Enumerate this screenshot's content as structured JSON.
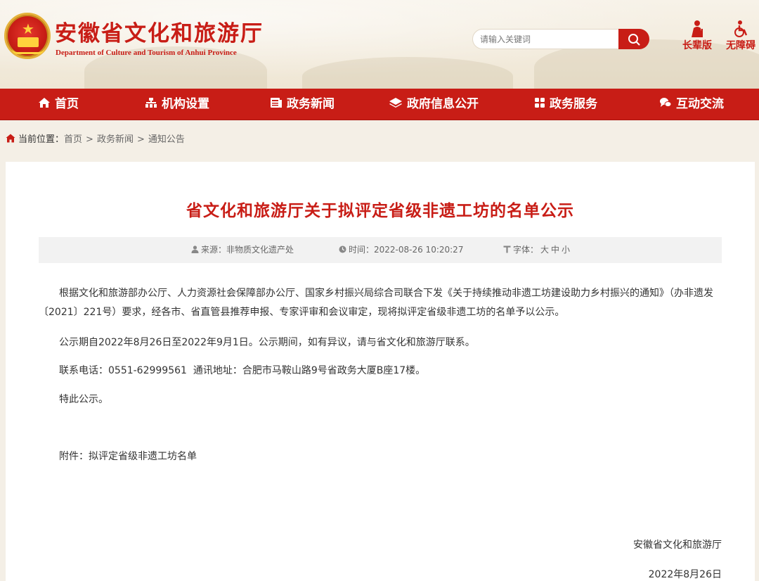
{
  "header": {
    "title": "安徽省文化和旅游厅",
    "subtitle": "Department of Culture and Tourism of Anhui Province",
    "search_placeholder": "请输入关键词",
    "elder_label": "长辈版",
    "accessible_label": "无障碍"
  },
  "nav": {
    "items": [
      {
        "label": "首页",
        "icon": "home-icon"
      },
      {
        "label": "机构设置",
        "icon": "org-chart-icon"
      },
      {
        "label": "政务新闻",
        "icon": "news-icon"
      },
      {
        "label": "政府信息公开",
        "icon": "layers-icon"
      },
      {
        "label": "政务服务",
        "icon": "grid-icon"
      },
      {
        "label": "互动交流",
        "icon": "chat-icon"
      }
    ]
  },
  "breadcrumb": {
    "label": "当前位置：",
    "items": [
      "首页",
      "政务新闻",
      "通知公告"
    ],
    "separator": ">"
  },
  "article": {
    "title": "省文化和旅游厅关于拟评定省级非遗工坊的名单公示",
    "meta": {
      "source": "来源：非物质文化遗产处",
      "time": "时间：2022-08-26 10:20:27",
      "font_label": "字体：",
      "font_options": [
        "大",
        "中",
        "小"
      ]
    },
    "paragraphs": [
      "根据文化和旅游部办公厅、人力资源社会保障部办公厅、国家乡村振兴局综合司联合下发《关于持续推动非遗工坊建设助力乡村振兴的通知》（办非遗发〔2021〕221号）要求，经各市、省直管县推荐申报、专家评审和会议审定，现将拟评定省级非遗工坊的名单予以公示。",
      "公示期自2022年8月26日至2022年9月1日。公示期间，如有异议，请与省文化和旅游厅联系。",
      "联系电话：0551-62999561  通讯地址：合肥市马鞍山路9号省政务大厦B座17楼。",
      "特此公示。"
    ],
    "attachment": "附件：拟评定省级非遗工坊名单",
    "signoff": {
      "org": "安徽省文化和旅游厅",
      "date": "2022年8月26日"
    }
  },
  "colors": {
    "brand_red": "#c81d16",
    "background": "#f4efe6",
    "meta_bar": "#f2f2f2"
  }
}
